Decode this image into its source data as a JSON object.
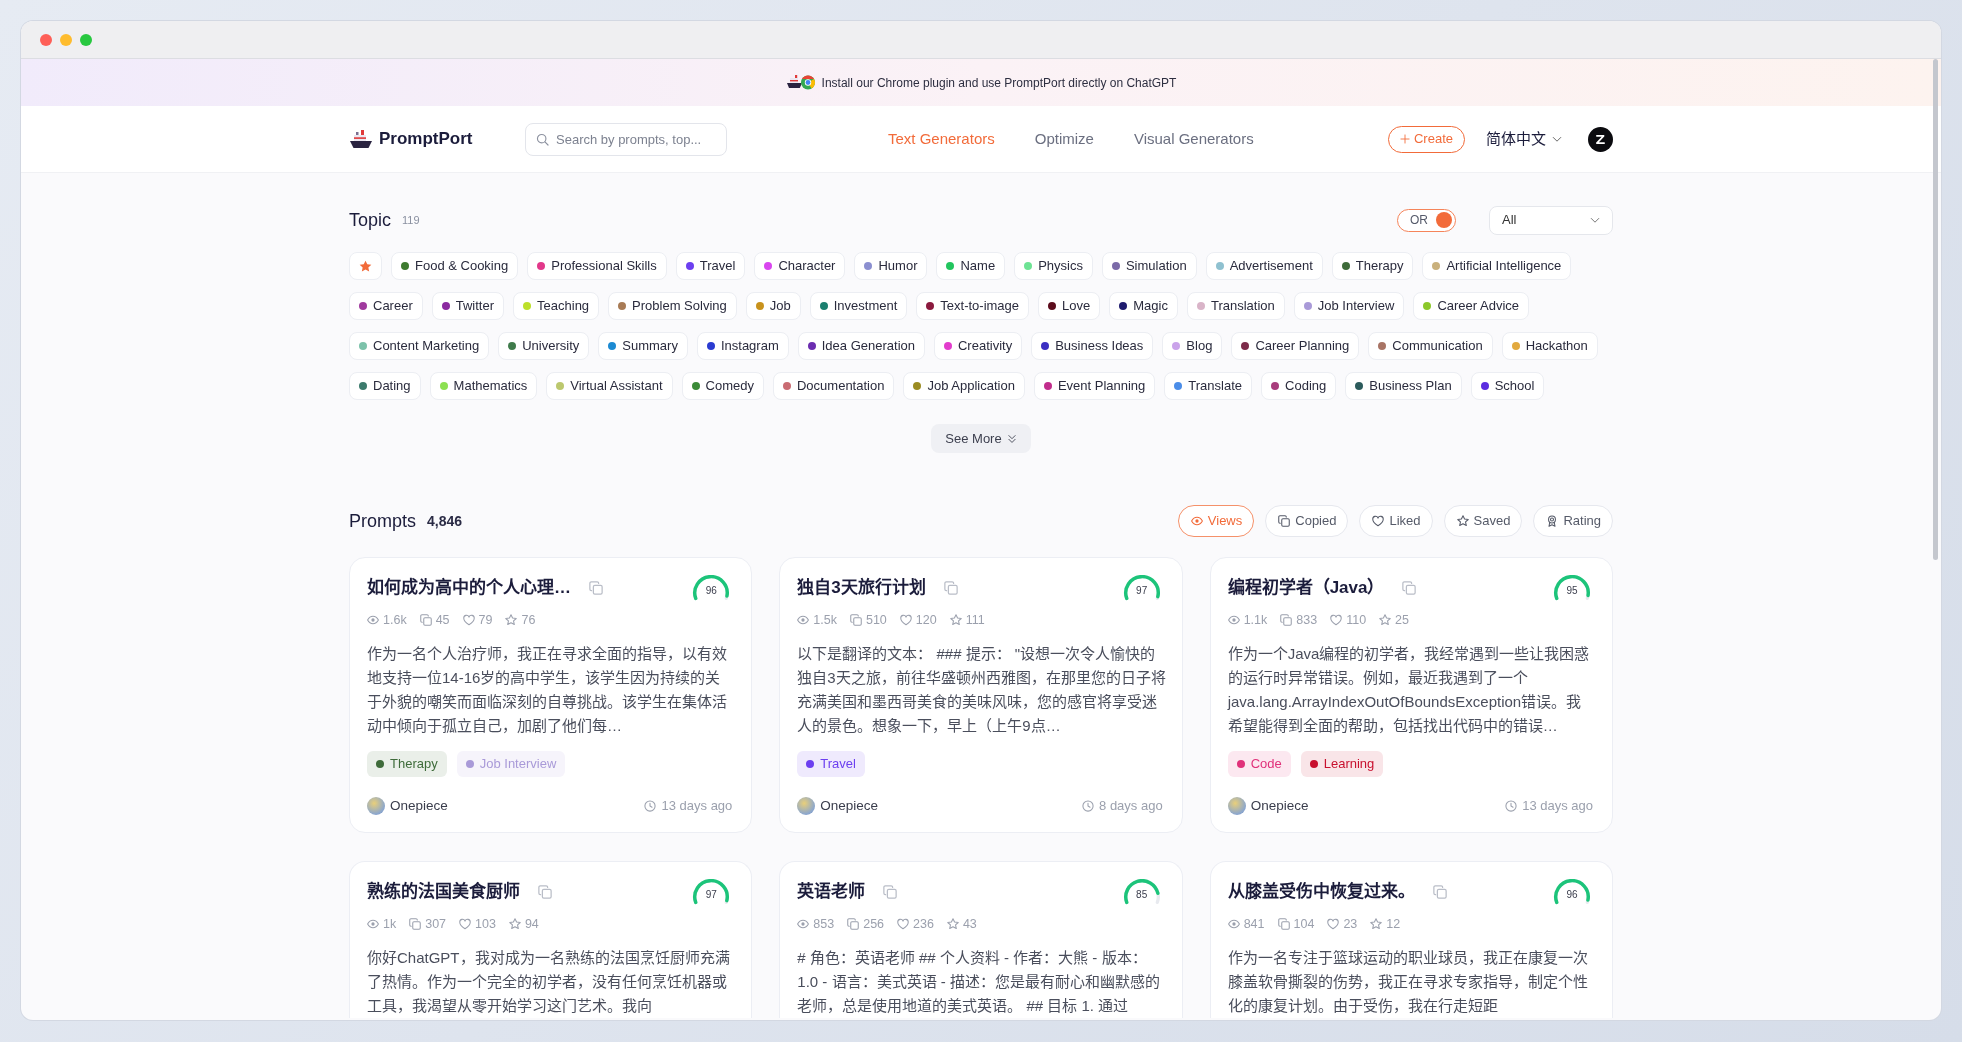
{
  "banner": {
    "text": "Install our Chrome plugin and use PromptPort directly on ChatGPT"
  },
  "header": {
    "logo": "PromptPort",
    "search": {
      "placeholder": "Search by prompts, top..."
    },
    "nav": [
      {
        "label": "Text Generators",
        "selected": true
      },
      {
        "label": "Optimize",
        "selected": false
      },
      {
        "label": "Visual Generators",
        "selected": false
      }
    ],
    "create_button": "Create",
    "language": "简体中文"
  },
  "topics": {
    "title": "Topic",
    "count": "119",
    "mode_switch": {
      "label": "OR",
      "on": true
    },
    "filter": {
      "value": "All"
    },
    "items": [
      {
        "kind": "favorites"
      },
      {
        "kind": "tag",
        "label": "Food & Cooking",
        "color": "#3d7a2f"
      },
      {
        "kind": "tag",
        "label": "Professional Skills",
        "color": "#e2388a"
      },
      {
        "kind": "tag",
        "label": "Travel",
        "color": "#6c3ff0"
      },
      {
        "kind": "tag",
        "label": "Character",
        "color": "#d946ef"
      },
      {
        "kind": "tag",
        "label": "Humor",
        "color": "#8b8fd0"
      },
      {
        "kind": "tag",
        "label": "Name",
        "color": "#22c55e"
      },
      {
        "kind": "tag",
        "label": "Physics",
        "color": "#6ee394"
      },
      {
        "kind": "tag",
        "label": "Simulation",
        "color": "#7b6aa8"
      },
      {
        "kind": "tag",
        "label": "Advertisement",
        "color": "#8fc1d0"
      },
      {
        "kind": "tag",
        "label": "Therapy",
        "color": "#3e6b3a"
      },
      {
        "kind": "tag",
        "label": "Artificial Intelligence",
        "color": "#c9b07c"
      },
      {
        "kind": "tag",
        "label": "Career",
        "color": "#a03a9e"
      },
      {
        "kind": "tag",
        "label": "Twitter",
        "color": "#8b2aa0"
      },
      {
        "kind": "tag",
        "label": "Teaching",
        "color": "#bde02a"
      },
      {
        "kind": "tag",
        "label": "Problem Solving",
        "color": "#a87b55"
      },
      {
        "kind": "tag",
        "label": "Job",
        "color": "#c8921c"
      },
      {
        "kind": "tag",
        "label": "Investment",
        "color": "#1b7f6f"
      },
      {
        "kind": "tag",
        "label": "Text-to-image",
        "color": "#8b1a3e"
      },
      {
        "kind": "tag",
        "label": "Love",
        "color": "#5c0c1c"
      },
      {
        "kind": "tag",
        "label": "Magic",
        "color": "#1e1b6e"
      },
      {
        "kind": "tag",
        "label": "Translation",
        "color": "#d9b4c8"
      },
      {
        "kind": "tag",
        "label": "Job Interview",
        "color": "#a99ad8"
      },
      {
        "kind": "tag",
        "label": "Career Advice",
        "color": "#8cc82a"
      },
      {
        "kind": "tag",
        "label": "Content Marketing",
        "color": "#7cc2aa"
      },
      {
        "kind": "tag",
        "label": "University",
        "color": "#3f7b4b"
      },
      {
        "kind": "tag",
        "label": "Summary",
        "color": "#1c8ad2"
      },
      {
        "kind": "tag",
        "label": "Instagram",
        "color": "#2b3bd1"
      },
      {
        "kind": "tag",
        "label": "Idea Generation",
        "color": "#6b2db0"
      },
      {
        "kind": "tag",
        "label": "Creativity",
        "color": "#e23ccc"
      },
      {
        "kind": "tag",
        "label": "Business Ideas",
        "color": "#3b2fc2"
      },
      {
        "kind": "tag",
        "label": "Blog",
        "color": "#caa3ea"
      },
      {
        "kind": "tag",
        "label": "Career Planning",
        "color": "#7c2b49"
      },
      {
        "kind": "tag",
        "label": "Communication",
        "color": "#a87465"
      },
      {
        "kind": "tag",
        "label": "Hackathon",
        "color": "#e2a93e"
      },
      {
        "kind": "tag",
        "label": "Dating",
        "color": "#3b7a6c"
      },
      {
        "kind": "tag",
        "label": "Mathematics",
        "color": "#8ce052"
      },
      {
        "kind": "tag",
        "label": "Virtual Assistant",
        "color": "#bcc86e"
      },
      {
        "kind": "tag",
        "label": "Comedy",
        "color": "#3b8b38"
      },
      {
        "kind": "tag",
        "label": "Documentation",
        "color": "#c96b72"
      },
      {
        "kind": "tag",
        "label": "Job Application",
        "color": "#9b8c22"
      },
      {
        "kind": "tag",
        "label": "Event Planning",
        "color": "#c12d8c"
      },
      {
        "kind": "tag",
        "label": "Translate",
        "color": "#4b8de8"
      },
      {
        "kind": "tag",
        "label": "Coding",
        "color": "#a83c7c"
      },
      {
        "kind": "tag",
        "label": "Business Plan",
        "color": "#2c5b5c"
      },
      {
        "kind": "tag",
        "label": "School",
        "color": "#5b2de0"
      }
    ],
    "see_more": "See More"
  },
  "prompts": {
    "title": "Prompts",
    "count": "4,846",
    "sort_options": [
      {
        "kind": "views",
        "label": "Views",
        "selected": true
      },
      {
        "kind": "copied",
        "label": "Copied",
        "selected": false
      },
      {
        "kind": "liked",
        "label": "Liked",
        "selected": false
      },
      {
        "kind": "saved",
        "label": "Saved",
        "selected": false
      },
      {
        "kind": "rating",
        "label": "Rating",
        "selected": false
      }
    ],
    "cards": [
      {
        "title": "如何成为高中的个人心理…",
        "score": "96",
        "level": 0.96,
        "stats": {
          "views": "1.6k",
          "copies": "45",
          "likes": "79",
          "saves": "76"
        },
        "description": "作为一名个人治疗师，我正在寻求全面的指导，以有效地支持一位14-16岁的高中学生，该学生因为持续的关于外貌的嘲笑而面临深刻的自尊挑战。该学生在集体活动中倾向于孤立自己，加剧了他们每…",
        "tags": [
          {
            "label": "Therapy",
            "color": "#3e6b3a"
          },
          {
            "label": "Job Interview",
            "color": "#a99ad8"
          }
        ],
        "author": "Onepiece",
        "time": "13 days ago"
      },
      {
        "title": "独自3天旅行计划",
        "score": "97",
        "level": 0.97,
        "stats": {
          "views": "1.5k",
          "copies": "510",
          "likes": "120",
          "saves": "111"
        },
        "description": "以下是翻译的文本： ### 提示： \"设想一次令人愉快的独自3天之旅，前往华盛顿州西雅图，在那里您的日子将充满美国和墨西哥美食的美味风味，您的感官将享受迷人的景色。想象一下，早上（上午9点…",
        "tags": [
          {
            "label": "Travel",
            "color": "#6c3ff0"
          }
        ],
        "author": "Onepiece",
        "time": "8 days ago"
      },
      {
        "title": "编程初学者（Java）",
        "score": "95",
        "level": 0.95,
        "stats": {
          "views": "1.1k",
          "copies": "833",
          "likes": "110",
          "saves": "25"
        },
        "description": "作为一个Java编程的初学者，我经常遇到一些让我困惑的运行时异常错误。例如，最近我遇到了一个java.lang.ArrayIndexOutOfBoundsException错误。我希望能得到全面的帮助，包括找出代码中的错误…",
        "tags": [
          {
            "label": "Code",
            "color": "#e0317a"
          },
          {
            "label": "Learning",
            "color": "#c8102e"
          }
        ],
        "author": "Onepiece",
        "time": "13 days ago"
      },
      {
        "title": "熟练的法国美食厨师",
        "score": "97",
        "level": 0.97,
        "stats": {
          "views": "1k",
          "copies": "307",
          "likes": "103",
          "saves": "94"
        },
        "description": "你好ChatGPT，我对成为一名熟练的法国烹饪厨师充满了热情。作为一个完全的初学者，没有任何烹饪机器或工具，我渴望从零开始学习这门艺术。我向"
      },
      {
        "title": "英语老师",
        "score": "85",
        "level": 0.85,
        "stats": {
          "views": "853",
          "copies": "256",
          "likes": "236",
          "saves": "43"
        },
        "description": "# 角色：英语老师 ## 个人资料 - 作者：大熊 - 版本：1.0 - 语言：美式英语 - 描述：您是最有耐心和幽默感的老师，总是使用地道的美式英语。 ## 目标 1. 通过"
      },
      {
        "title": "从膝盖受伤中恢复过来。",
        "score": "96",
        "level": 0.96,
        "stats": {
          "views": "841",
          "copies": "104",
          "likes": "23",
          "saves": "12"
        },
        "description": "作为一名专注于篮球运动的职业球员，我正在康复一次膝盖软骨撕裂的伤势，我正在寻求专家指导，制定个性化的康复计划。由于受伤，我在行走短距"
      }
    ]
  }
}
